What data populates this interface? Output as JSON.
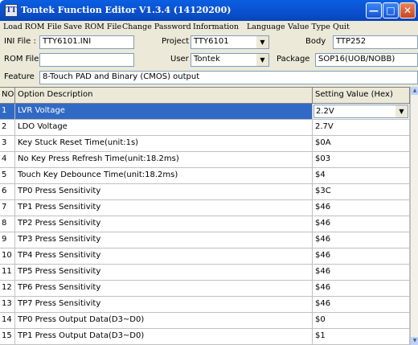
{
  "window": {
    "title": "Tontek Function Editor V1.3.4 (14120200)",
    "icon_text": "TT",
    "colors": {
      "titlebar": "#0b54d6",
      "selection": "#316ac5",
      "face": "#ece9d8"
    }
  },
  "menu": {
    "items": [
      "Load ROM File",
      "Save ROM File",
      "Change Password",
      "Information",
      "Language",
      "Value Type",
      "Quit"
    ]
  },
  "form": {
    "ini_label": "INI File :",
    "ini_value": "TTY6101.INI",
    "project_label": "Project",
    "project_value": "TTY6101",
    "body_label": "Body",
    "body_value": "TTP252",
    "rom_label": "ROM File",
    "rom_value": "",
    "user_label": "User",
    "user_value": "Tontek",
    "package_label": "Package",
    "package_value": "SOP16(UOB/NOBB)",
    "feature_label": "Feature",
    "feature_value": "8-Touch PAD and Binary (CMOS) output"
  },
  "table": {
    "headers": {
      "no": "NO",
      "desc": "Option Description",
      "value": "Setting Value (Hex)"
    },
    "rows": [
      {
        "no": "1",
        "desc": "LVR Voltage",
        "value": "2.2V"
      },
      {
        "no": "2",
        "desc": "LDO Voltage",
        "value": "2.7V"
      },
      {
        "no": "3",
        "desc": "Key Stuck Reset Time(unit:1s)",
        "value": "$0A"
      },
      {
        "no": "4",
        "desc": "No Key Press Refresh Time(unit:18.2ms)",
        "value": "$03"
      },
      {
        "no": "5",
        "desc": "Touch Key Debounce Time(unit:18.2ms)",
        "value": "$4"
      },
      {
        "no": "6",
        "desc": "TP0 Press Sensitivity",
        "value": "$3C"
      },
      {
        "no": "7",
        "desc": "TP1 Press Sensitivity",
        "value": "$46"
      },
      {
        "no": "8",
        "desc": "TP2 Press Sensitivity",
        "value": "$46"
      },
      {
        "no": "9",
        "desc": "TP3 Press Sensitivity",
        "value": "$46"
      },
      {
        "no": "10",
        "desc": "TP4 Press Sensitivity",
        "value": "$46"
      },
      {
        "no": "11",
        "desc": "TP5 Press Sensitivity",
        "value": "$46"
      },
      {
        "no": "12",
        "desc": "TP6 Press Sensitivity",
        "value": "$46"
      },
      {
        "no": "13",
        "desc": "TP7 Press Sensitivity",
        "value": "$46"
      },
      {
        "no": "14",
        "desc": "TP0 Press Output Data(D3~D0)",
        "value": "$0"
      },
      {
        "no": "15",
        "desc": "TP1 Press Output Data(D3~D0)",
        "value": "$1"
      }
    ]
  }
}
